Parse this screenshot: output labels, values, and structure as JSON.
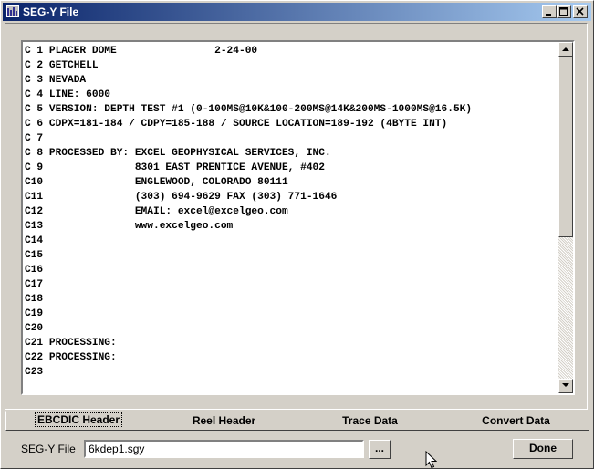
{
  "window": {
    "title": "SEG-Y File"
  },
  "ebcdic_lines": [
    "C 1 PLACER DOME                2-24-00",
    "C 2 GETCHELL",
    "C 3 NEVADA",
    "C 4 LINE: 6000",
    "C 5 VERSION: DEPTH TEST #1 (0-100MS@10K&100-200MS@14K&200MS-1000MS@16.5K)",
    "C 6 CDPX=181-184 / CDPY=185-188 / SOURCE LOCATION=189-192 (4BYTE INT)",
    "C 7",
    "C 8 PROCESSED BY: EXCEL GEOPHYSICAL SERVICES, INC.",
    "C 9               8301 EAST PRENTICE AVENUE, #402",
    "C10               ENGLEWOOD, COLORADO 80111",
    "C11               (303) 694-9629 FAX (303) 771-1646",
    "C12               EMAIL: excel@excelgeo.com",
    "C13               www.excelgeo.com",
    "C14",
    "C15",
    "C16",
    "C17",
    "C18",
    "C19",
    "C20",
    "C21 PROCESSING:",
    "C22 PROCESSING:",
    "C23"
  ],
  "tabs": [
    {
      "label": "EBCDIC Header",
      "active": true
    },
    {
      "label": "Reel Header",
      "active": false
    },
    {
      "label": "Trace Data",
      "active": false
    },
    {
      "label": "Convert Data",
      "active": false
    }
  ],
  "footer": {
    "segy_label": "SEG-Y File",
    "segy_value": "6kdep1.sgy",
    "browse_label": "...",
    "done_label": "Done"
  },
  "icons": {
    "app": "seismic-app-icon",
    "minimize": "minimize-icon",
    "maximize": "maximize-icon",
    "close": "close-icon",
    "scroll_up": "scroll-up-arrow-icon",
    "scroll_down": "scroll-down-arrow-icon",
    "cursor": "mouse-cursor-icon"
  },
  "colors": {
    "titlebar_start": "#0a246a",
    "titlebar_end": "#a6caf0",
    "face": "#d4d0c8"
  }
}
